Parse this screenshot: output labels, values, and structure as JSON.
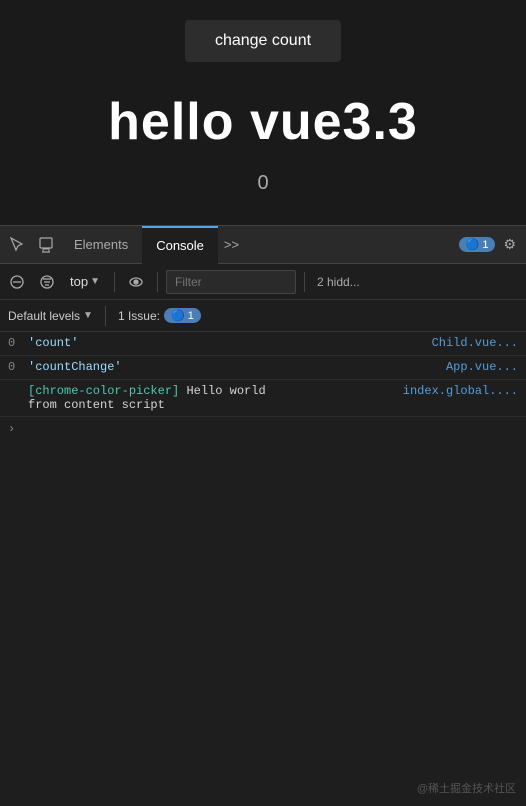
{
  "page": {
    "button_label": "change count",
    "hello_text": "hello vue3.3",
    "count_value": "0"
  },
  "devtools": {
    "tabs": [
      {
        "label": "Elements",
        "active": false
      },
      {
        "label": "Console",
        "active": true
      }
    ],
    "more_tabs_label": ">>",
    "badge_count": "1",
    "toolbar2": {
      "top_label": "top",
      "filter_placeholder": "Filter",
      "hidden_label": "2 hidd..."
    },
    "toolbar3": {
      "default_levels": "Default levels",
      "issue_label": "1 Issue:",
      "issue_count": "1"
    },
    "console_rows": [
      {
        "number": "0",
        "text": "'count'",
        "source": "Child.vue..."
      },
      {
        "number": "0",
        "text": "'countChange'",
        "source": "App.vue..."
      },
      {
        "number": "",
        "text": "[chrome-color-picker] Hello world\nfrom content script",
        "source": "index.global...."
      }
    ],
    "watermark": "@稀土掘金技术社区"
  }
}
